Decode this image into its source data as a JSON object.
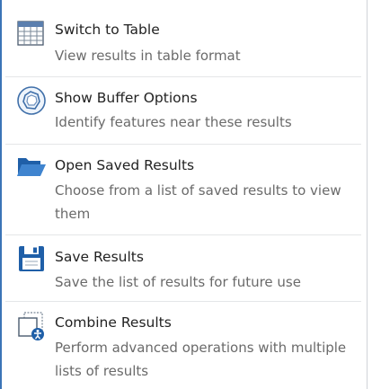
{
  "menu": {
    "items": [
      {
        "title": "Switch to Table",
        "description": "View results in table format",
        "icon": "table-icon"
      },
      {
        "title": "Show Buffer Options",
        "description": "Identify features near these results",
        "icon": "buffer-icon"
      },
      {
        "title": "Open Saved Results",
        "description": "Choose from a list of saved results to view them",
        "icon": "folder-open-icon"
      },
      {
        "title": "Save Results",
        "description": "Save the list of results for future use",
        "icon": "save-icon"
      },
      {
        "title": "Combine Results",
        "description": "Perform advanced operations with multiple lists of results",
        "icon": "combine-icon"
      }
    ]
  },
  "colors": {
    "accent_border": "#3b74b7",
    "icon_blue": "#1f5fa8",
    "title_text": "#222222",
    "description_text": "#6a6a6a",
    "divider": "#e4e6e8"
  }
}
